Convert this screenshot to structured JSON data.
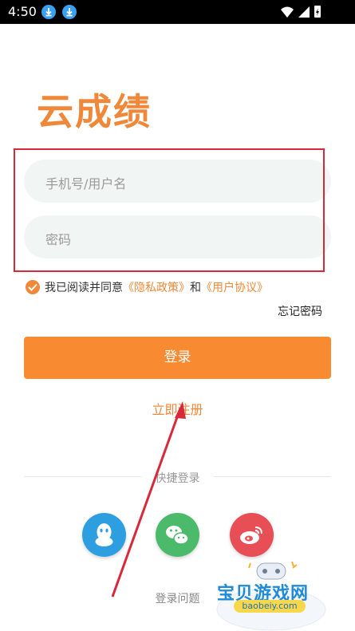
{
  "status_bar": {
    "time": "4:50",
    "icons": [
      "download-icon",
      "download-icon",
      "wifi-icon",
      "signal-icon",
      "battery-icon"
    ]
  },
  "brand": {
    "logo_text": "云成绩",
    "color": "#f0883a"
  },
  "form": {
    "username_placeholder": "手机号/用户名",
    "password_placeholder": "密码"
  },
  "agreement": {
    "prefix": "我已阅读并同意",
    "privacy_link": "《隐私政策》",
    "and": "和",
    "user_agreement_link": "《用户协议》",
    "checked": true
  },
  "forgot_password": "忘记密码",
  "login_button": "登录",
  "register_link": "立即注册",
  "quick_login": {
    "title": "快捷登录",
    "providers": [
      "qq-icon",
      "wechat-icon",
      "weibo-icon"
    ]
  },
  "help_link": "登录问题",
  "watermark": {
    "text": "宝贝游戏网",
    "url": "baobeiy.com"
  },
  "colors": {
    "accent": "#f88a32",
    "annotation": "#d9283a"
  }
}
